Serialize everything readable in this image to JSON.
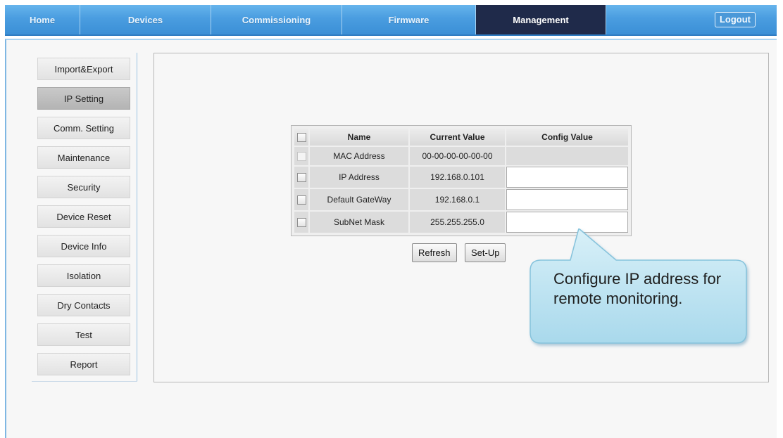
{
  "nav": {
    "home": "Home",
    "devices": "Devices",
    "commissioning": "Commissioning",
    "firmware": "Firmware",
    "management": "Management",
    "logout": "Logout"
  },
  "side_menu": {
    "items": [
      {
        "label": "Import&Export"
      },
      {
        "label": "IP Setting"
      },
      {
        "label": "Comm. Setting"
      },
      {
        "label": "Maintenance"
      },
      {
        "label": "Security"
      },
      {
        "label": "Device Reset"
      },
      {
        "label": "Device Info"
      },
      {
        "label": "Isolation"
      },
      {
        "label": "Dry Contacts"
      },
      {
        "label": "Test"
      },
      {
        "label": "Report"
      }
    ],
    "active": "IP Setting"
  },
  "table": {
    "headers": {
      "name": "Name",
      "current": "Current Value",
      "config": "Config Value"
    },
    "rows": [
      {
        "name": "MAC Address",
        "current": "00-00-00-00-00-00",
        "config": ""
      },
      {
        "name": "IP Address",
        "current": "192.168.0.101",
        "config": ""
      },
      {
        "name": "Default GateWay",
        "current": "192.168.0.1",
        "config": ""
      },
      {
        "name": "SubNet Mask",
        "current": "255.255.255.0",
        "config": ""
      }
    ]
  },
  "buttons": {
    "refresh": "Refresh",
    "setup": "Set-Up"
  },
  "callout": {
    "text": "Configure IP address for remote monitoring."
  },
  "colors": {
    "nav_blue": "#4a9de0",
    "active_tab": "#1f2a4a",
    "callout_fill": "#bfe3f1"
  }
}
